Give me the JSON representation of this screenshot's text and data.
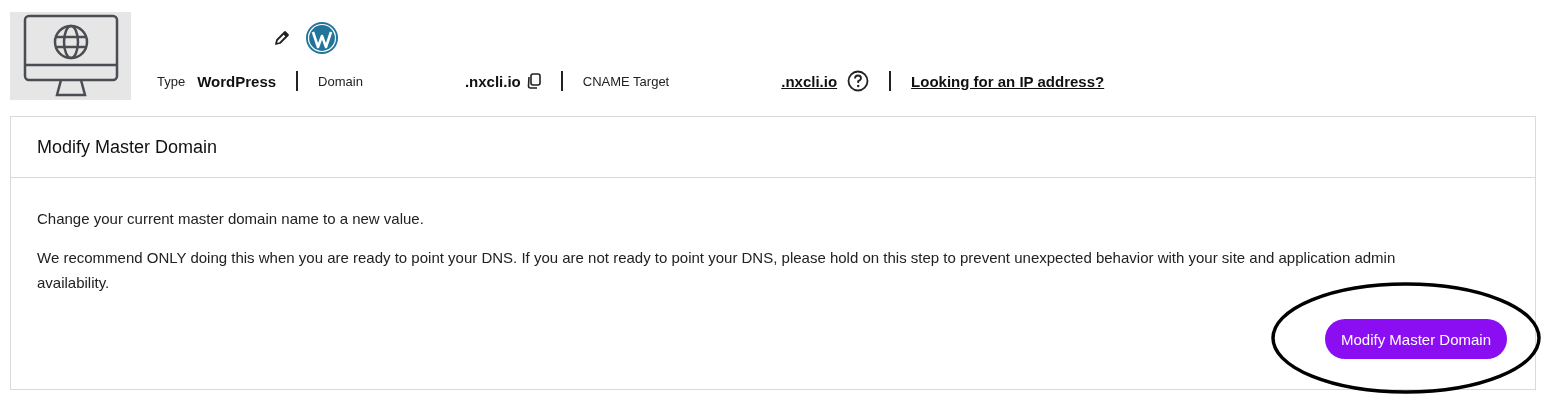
{
  "site": {
    "type_label": "Type",
    "type_value": "WordPress",
    "domain_label": "Domain",
    "domain_value": ".nxcli.io",
    "cname_label": "CNAME Target",
    "cname_value": ".nxcli.io",
    "ip_link": "Looking for an IP address?"
  },
  "card": {
    "title": "Modify Master Domain",
    "paragraphs": [
      "Change your current master domain name to a new value.",
      "We recommend ONLY doing this when you are ready to point your DNS. If you are not ready to point your DNS, please hold on this step to prevent unexpected behavior with your site and application admin availability."
    ],
    "button": "Modify Master Domain",
    "button_circled": true
  }
}
